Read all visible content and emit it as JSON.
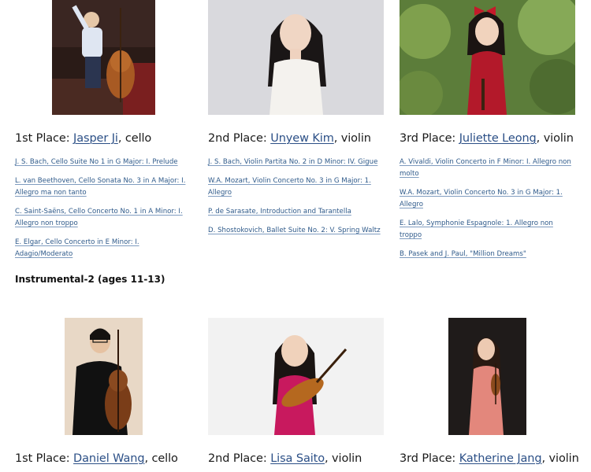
{
  "group1": {
    "winners": [
      {
        "place_prefix": "1st Place: ",
        "name": "Jasper Ji",
        "instrument_suffix": ", cello",
        "pieces": [
          "J. S. Bach, Cello Suite No 1 in G Major: I. Prelude",
          "L. van Beethoven, Cello Sonata No. 3 in A Major: I. Allegro ma non tanto",
          "C. Saint-Saëns, Cello Concerto No. 1 in A Minor: I. Allegro non troppo",
          "E. Elgar, Cello Concerto in E Minor: I. Adagio/Moderato"
        ]
      },
      {
        "place_prefix": "2nd Place: ",
        "name": "Unyew Kim",
        "instrument_suffix": ", violin",
        "pieces": [
          "J. S. Bach, Violin Partita No. 2 in D Minor: IV. Gigue",
          "W.A. Mozart, Violin Concerto No. 3 in G Major: 1. Allegro",
          "P. de Sarasate, Introduction and Tarantella",
          "D. Shostokovich, Ballet Suite No. 2: V. Spring Waltz"
        ]
      },
      {
        "place_prefix": "3rd Place: ",
        "name": "Juliette Leong",
        "instrument_suffix": ", violin",
        "pieces": [
          "A. Vivaldi, Violin Concerto in F Minor: I. Allegro non molto",
          "W.A. Mozart, Violin Concerto No. 3 in G Major: 1. Allegro",
          "E. Lalo, Symphonie Espagnole: 1. Allegro non troppo",
          "B. Pasek and J. Paul, \"Million Dreams\""
        ]
      }
    ]
  },
  "group2": {
    "heading": "Instrumental-2 (ages 11-13)",
    "winners": [
      {
        "place_prefix": "1st Place: ",
        "name": "Daniel Wang",
        "instrument_suffix": ", cello"
      },
      {
        "place_prefix": "2nd Place: ",
        "name": "Lisa Saito",
        "instrument_suffix": ", violin"
      },
      {
        "place_prefix": "3rd Place: ",
        "name": "Katherine Jang",
        "instrument_suffix": ", violin"
      }
    ]
  },
  "colors": {
    "link": "#2b4f86",
    "piece_link": "#2f5a8a",
    "text": "#1a1a1a"
  }
}
